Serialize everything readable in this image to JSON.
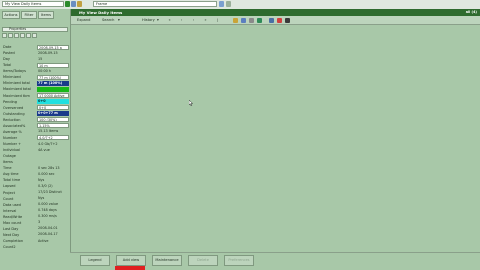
{
  "top": {
    "path_field": "My View Daily Items",
    "search_field": "Frame"
  },
  "left": {
    "tabs": [
      "Actions",
      "Filter",
      "Items"
    ],
    "header": "Properties"
  },
  "properties": [
    {
      "label": "Date",
      "value": "2008-09-15 a",
      "style": "box"
    },
    {
      "label": "Posted",
      "value": "2008-09-15",
      "style": "plain"
    },
    {
      "label": "Day",
      "value": "15",
      "style": "plain"
    },
    {
      "label": "Total",
      "value": "10 m",
      "style": "box"
    },
    {
      "label": "Items/Todays",
      "value": "00:00 h",
      "style": "plain"
    },
    {
      "label": "Minimized",
      "value": "77 m (100%)",
      "style": "box"
    },
    {
      "label": "Minimized total",
      "value": "77 m (100%)",
      "style": "navy"
    },
    {
      "label": "Maximized total",
      "value": "",
      "style": "green"
    },
    {
      "label": "Maximized tbm",
      "value": "1T 0000 Active",
      "style": "box"
    },
    {
      "label": "Pending",
      "value": "0+0",
      "style": "cyan"
    },
    {
      "label": "Overserved",
      "value": "0+0",
      "style": "box"
    },
    {
      "label": "Outstanding",
      "value": "0+0+77 m",
      "style": "navy"
    },
    {
      "label": "Reduction",
      "value": "100 (30%)",
      "style": "box"
    },
    {
      "label": "Associated%",
      "value": "1.15%",
      "style": "box"
    },
    {
      "label": "Average %",
      "value": "15.13 Items",
      "style": "plain"
    },
    {
      "label": "Number",
      "value": "4.0/7+2",
      "style": "box"
    },
    {
      "label": "Number +",
      "value": "4.0 Gb/7+2",
      "style": "plain"
    },
    {
      "label": "Individual",
      "value": "4A vue",
      "style": "plain"
    },
    {
      "label": "Outage",
      "value": "",
      "style": "plain"
    },
    {
      "label": "Items",
      "value": "",
      "style": "plain"
    },
    {
      "label": "Time",
      "value": "0 sec 28s 13",
      "style": "plain"
    },
    {
      "label": "Avg time",
      "value": "0.000 sec",
      "style": "plain"
    },
    {
      "label": "Total time",
      "value": "Nys",
      "style": "plain"
    },
    {
      "label": "Lapsed",
      "value": "0.3/0 (2)",
      "style": "plain"
    },
    {
      "label": "Project",
      "value": "17/23 Distinct",
      "style": "plain"
    },
    {
      "label": "Count",
      "value": "Nys",
      "style": "plain"
    },
    {
      "label": "Data used",
      "value": "0.000 value",
      "style": "plain"
    },
    {
      "label": "Interval",
      "value": "0.748 days",
      "style": "plain"
    },
    {
      "label": "Read/Write",
      "value": "0.300 ms/s",
      "style": "plain"
    },
    {
      "label": "Max count",
      "value": "3",
      "style": "plain"
    },
    {
      "label": "Last Day",
      "value": "2008-04-01",
      "style": "plain"
    },
    {
      "label": "Next Day",
      "value": "2008-04-17",
      "style": "plain"
    },
    {
      "label": "Completion",
      "value": "Active",
      "style": "plain"
    },
    {
      "label": "Count2",
      "value": "",
      "style": "plain"
    }
  ],
  "window": {
    "title": "My View Daily Items",
    "corner": "all (4)",
    "toolbar": {
      "expand": "Expand",
      "search": "Search",
      "history": "History"
    },
    "nav_glyphs": [
      "«",
      "‹",
      "›",
      "»",
      "|"
    ]
  },
  "bottom": {
    "buttons": [
      "Legend",
      "Add view",
      "Maintenance",
      "Delete",
      "Preferences"
    ],
    "dim": [
      false,
      false,
      false,
      true,
      true
    ]
  },
  "colors": {
    "background": "#a8c8a8",
    "title_bar": "#2e6b2e",
    "navy_cell": "#1a3a8a",
    "green_cell": "#18b818",
    "cyan_cell": "#20e0e0",
    "red_bar": "#e02020"
  }
}
